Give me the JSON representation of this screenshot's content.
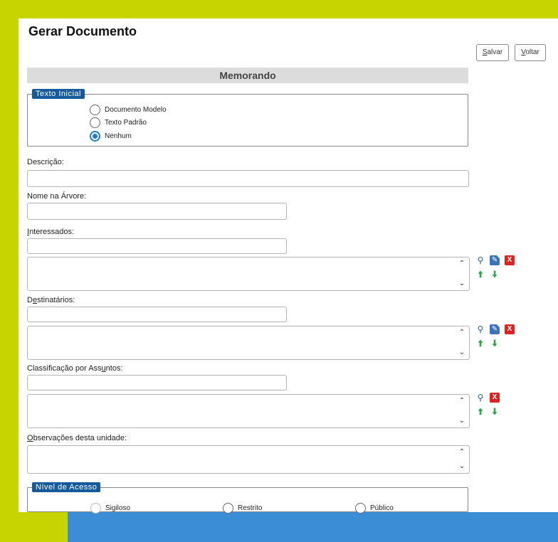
{
  "page": {
    "title": "Gerar Documento"
  },
  "toolbar": {
    "save_label": "Salvar",
    "save_key": "S",
    "save_rest": "alvar",
    "back_key": "V",
    "back_rest": "oltar"
  },
  "document_type": "Memorando",
  "texto_inicial": {
    "legend": "Texto Inicial",
    "options": [
      {
        "label": "Documento Modelo",
        "selected": false
      },
      {
        "label": "Texto Padrão",
        "selected": false
      },
      {
        "label": "Nenhum",
        "selected": true
      }
    ]
  },
  "descricao": {
    "label": "Descrição:",
    "value": ""
  },
  "nome_arvore": {
    "label": "Nome na Árvore:",
    "value": ""
  },
  "interessados": {
    "label_key": "I",
    "label_rest": "nteressados:",
    "value": ""
  },
  "destinatarios": {
    "label_pre": "D",
    "label_key": "e",
    "label_rest": "stinatários:",
    "value": ""
  },
  "classificacao": {
    "label_pre": "Classificação por Ass",
    "label_key": "u",
    "label_rest": "ntos:",
    "value": ""
  },
  "observacoes": {
    "label_key": "O",
    "label_rest": "bservações desta unidade:",
    "value": ""
  },
  "nivel_acesso": {
    "legend": "Nível de Acesso",
    "options": [
      {
        "label": "Sigiloso",
        "disabled": true
      },
      {
        "label": "Restrito",
        "disabled": false
      },
      {
        "label": "Público",
        "disabled": false
      }
    ]
  },
  "colors": {
    "accent": "#1a7fd4",
    "legend_bg": "#155a9c",
    "outer_green": "#c8d400",
    "outer_blue": "#3b8ed6",
    "remove_red": "#dd2222",
    "arrow_green": "#2aa84a"
  },
  "icons": {
    "search": "search-icon",
    "edit": "edit-icon",
    "remove": "remove-icon",
    "up": "arrow-up-icon",
    "down": "arrow-down-icon"
  }
}
